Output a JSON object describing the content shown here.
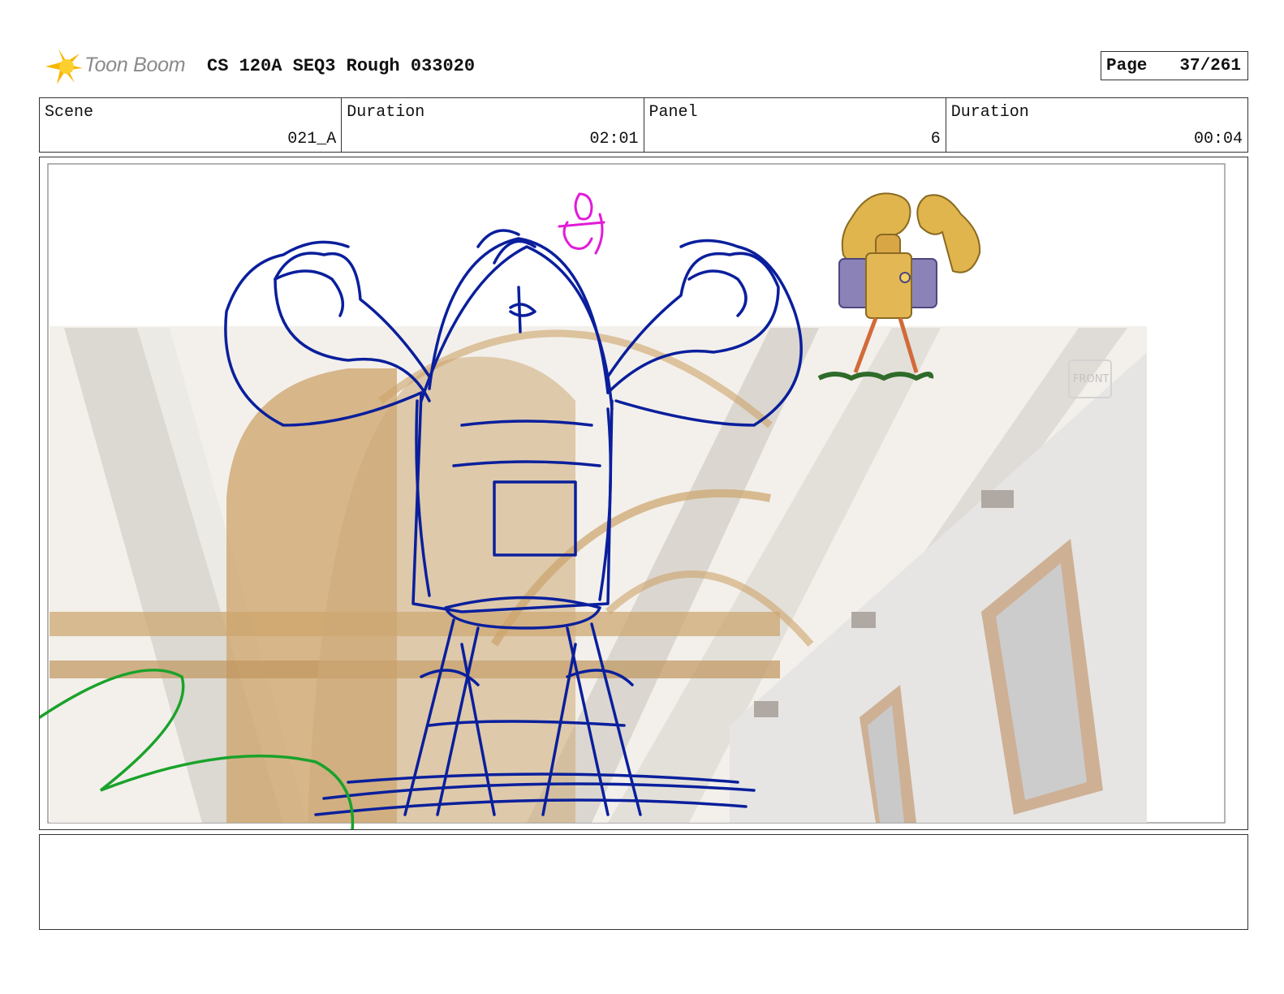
{
  "header": {
    "logo_text": "Toon Boom",
    "doc_title": "CS 120A SEQ3 Rough 033020",
    "page_label": "Page",
    "page_value": "37/261"
  },
  "info": {
    "scene_label": "Scene",
    "scene_value": "021_A",
    "duration_label": "Duration",
    "duration_value": "02:01",
    "panel_label": "Panel",
    "panel_value": "6",
    "panel_duration_label": "Duration",
    "panel_duration_value": "00:04"
  },
  "panel": {
    "sign_text": "FRONT"
  },
  "notes": {
    "text": ""
  },
  "colors": {
    "sketch_blue": "#0a1f9c",
    "sketch_magenta": "#e21ad8",
    "sketch_green": "#1aa22a",
    "logo_yellow": "#f5b800",
    "wood": "#c89a5a"
  }
}
